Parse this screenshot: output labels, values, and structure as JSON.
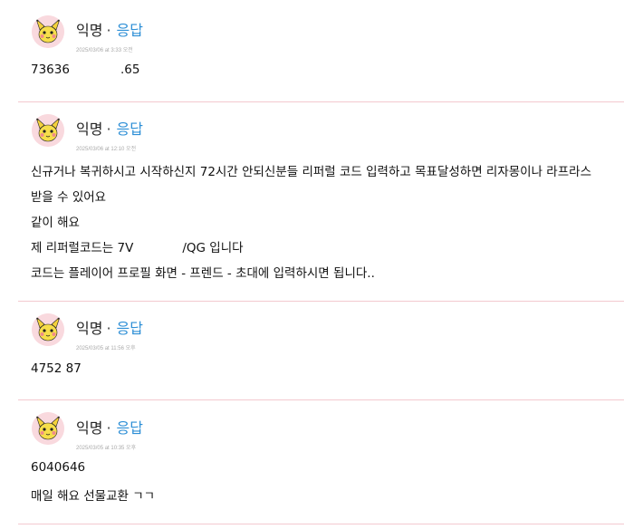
{
  "comments": [
    {
      "author": "익명",
      "reply_label": "응답",
      "timestamp": "2025/03/06 at 3:33 오전",
      "lines": [
        "73636",
        ".65"
      ]
    },
    {
      "author": "익명",
      "reply_label": "응답",
      "timestamp": "2025/03/06 at 12:10 오전",
      "lines": [
        "신규거나 복귀하시고 시작하신지 72시간 안되신분들 리퍼럴 코드 입력하고 목표달성하면 리자몽이나 라프라스",
        "받을 수 있어요",
        "같이 해요",
        "제 리퍼럴코드는 7V",
        "/QG 입니다",
        "코드는 플레이어 프로필 화면 - 프렌드 - 초대에 입력하시면 됩니다.."
      ]
    },
    {
      "author": "익명",
      "reply_label": "응답",
      "timestamp": "2025/03/05 at 11:56 오후",
      "lines": [
        "4752 87"
      ]
    },
    {
      "author": "익명",
      "reply_label": "응답",
      "timestamp": "2025/03/05 at 10:35 오후",
      "lines": [
        "6040646",
        "매일 해요 선물교환 ㄱㄱ"
      ]
    }
  ]
}
